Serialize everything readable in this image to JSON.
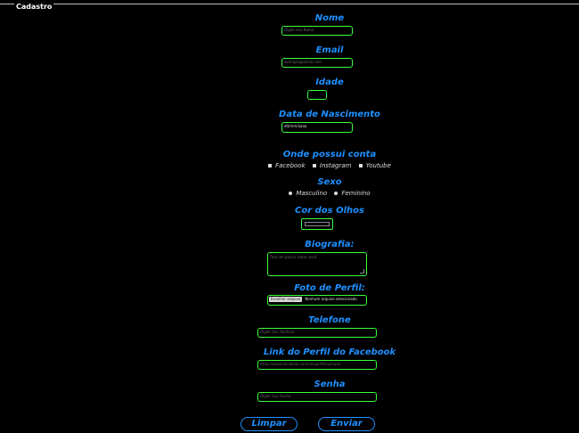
{
  "form": {
    "legend": "Cadastro",
    "nome": {
      "label": "Nome",
      "placeholder": "Digite seu Nome"
    },
    "email": {
      "label": "Email",
      "placeholder": "exemplo@email.com"
    },
    "idade": {
      "label": "Idade",
      "value": ""
    },
    "nascimento": {
      "label": "Data de Nascimento",
      "value": "dd/mm/aaaa"
    },
    "contas": {
      "label": "Onde possui conta",
      "options": [
        "Facebook",
        "Instagram",
        "Youtube"
      ]
    },
    "sexo": {
      "label": "Sexo",
      "options": [
        "Masculino",
        "Feminino"
      ]
    },
    "olhos": {
      "label": "Cor dos Olhos",
      "color": "#000000"
    },
    "biografia": {
      "label": "Biografia:",
      "placeholder": "Fale um pouco sobre você"
    },
    "foto": {
      "label": "Foto de Perfil:",
      "button": "Escolher arquivo",
      "status": "Nenhum arquivo selecionado"
    },
    "telefone": {
      "label": "Telefone",
      "placeholder": "Digite Seu Telefone"
    },
    "facebook": {
      "label": "Link do Perfil do Facebook",
      "placeholder": "https://www.facebook.com/seuperfil/exemplo"
    },
    "senha": {
      "label": "Senha",
      "placeholder": "Digite Sua Senha"
    },
    "buttons": {
      "limpar": "Limpar",
      "enviar": "Enviar"
    }
  },
  "colors": {
    "label": "#1e90ff",
    "border": "#3bff3b",
    "background": "#000000"
  }
}
